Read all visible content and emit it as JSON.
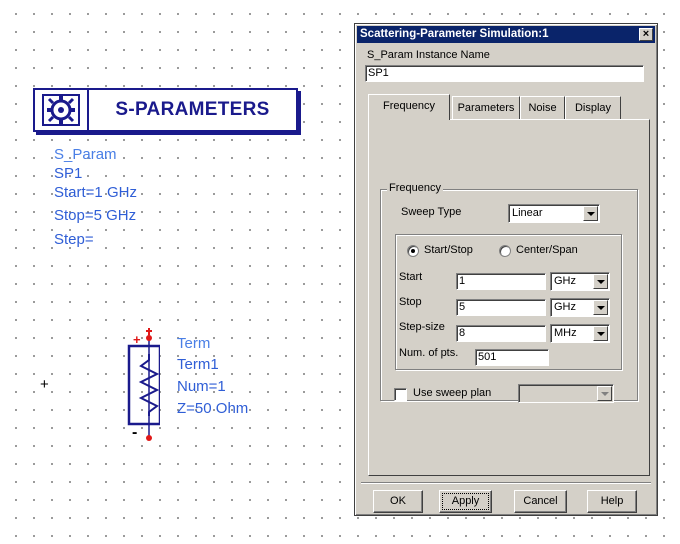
{
  "schematic": {
    "sp_component": {
      "title": "S-PARAMETERS",
      "icon": "s-param-simulation-icon",
      "params": [
        "S_Param",
        "SP1",
        "Start=1 GHz",
        "Stop=5 GHz",
        "Step="
      ]
    },
    "term_component": {
      "params": [
        "Term",
        "Term1",
        "Num=1",
        "Z=50 Ohm"
      ],
      "plus_label": "+",
      "minus_label": "-",
      "pin_color": "#e01818",
      "wire_color": "#1a1a8c"
    },
    "cursor_marker": "+"
  },
  "dialog": {
    "title": "Scattering-Parameter Simulation:1",
    "close_label": "×",
    "instance_label": "S_Param Instance Name",
    "instance_value": "SP1",
    "tabs": [
      "Frequency",
      "Parameters",
      "Noise",
      "Display"
    ],
    "active_tab": "Frequency",
    "frequency_group_label": "Frequency",
    "sweep_type_label": "Sweep Type",
    "sweep_type_value": "Linear",
    "radio_start_stop": "Start/Stop",
    "radio_center_span": "Center/Span",
    "selected_mode": "Start/Stop",
    "start_label": "Start",
    "start_value": "1",
    "start_unit": "GHz",
    "stop_label": "Stop",
    "stop_value": "5",
    "stop_unit": "GHz",
    "step_label": "Step-size",
    "step_value": "8",
    "step_unit": "MHz",
    "numpts_label": "Num. of pts.",
    "numpts_value": "501",
    "sweep_plan_label": "Use sweep plan",
    "sweep_plan_checked": false,
    "sweep_plan_value": "",
    "buttons": {
      "ok": "OK",
      "apply": "Apply",
      "cancel": "Cancel",
      "help": "Help"
    }
  },
  "colors": {
    "accent_blue": "#1a1a8c",
    "param_text": "#2f5ed6",
    "titlebar": "#0a246a",
    "dialog_face": "#d4d0c8"
  }
}
